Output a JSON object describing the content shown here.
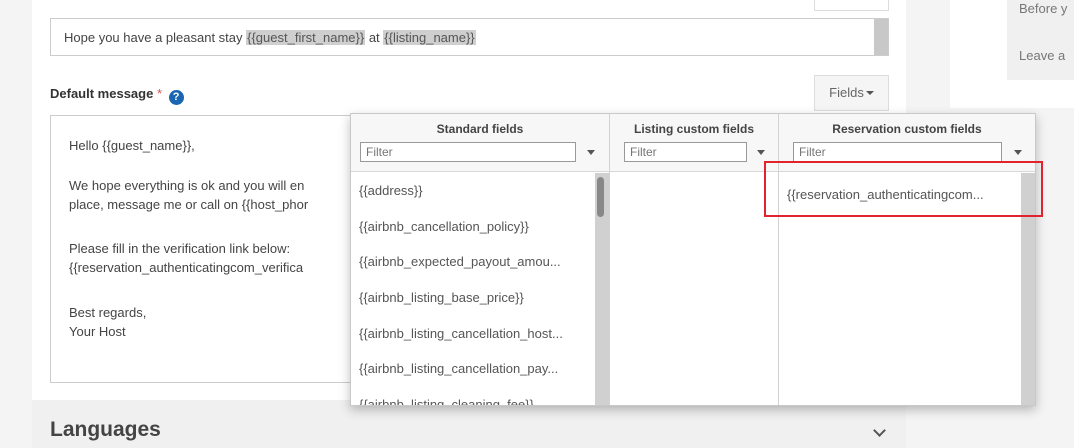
{
  "subject": {
    "text_before": "Hope you have a pleasant stay ",
    "tag1": "{{guest_first_name}}",
    "text_mid": " at ",
    "tag2": "{{listing_name}}"
  },
  "default_message": {
    "label": "Default message",
    "required_mark": "*",
    "help_icon": "?",
    "fields_button": "Fields",
    "lines": [
      "Hello {{guest_name}},",
      "We hope everything is ok and you will en",
      "place, message me or call on {{host_phor",
      "Please fill in the verification link below:",
      "{{reservation_authenticatingcom_verifica",
      "Best regards,",
      "Your Host"
    ]
  },
  "languages": {
    "title": "Languages"
  },
  "side": {
    "btn1": "Before y",
    "btn2": "Leave a"
  },
  "dropdown": {
    "standard": {
      "title": "Standard fields",
      "filter_placeholder": "Filter",
      "items": [
        "{{address}}",
        "{{airbnb_cancellation_policy}}",
        "{{airbnb_expected_payout_amou...",
        "{{airbnb_listing_base_price}}",
        "{{airbnb_listing_cancellation_host...",
        "{{airbnb_listing_cancellation_pay...",
        "{{airbnb_listing_cleaning_fee}}"
      ]
    },
    "listing": {
      "title": "Listing custom fields",
      "filter_placeholder": "Filter",
      "items": []
    },
    "reservation": {
      "title": "Reservation custom fields",
      "filter_placeholder": "Filter",
      "items": [
        "{{reservation_authenticatingcom..."
      ]
    }
  },
  "colors": {
    "accent": "#1a66b3",
    "required": "#d9534f",
    "highlight": "#e0232d"
  }
}
